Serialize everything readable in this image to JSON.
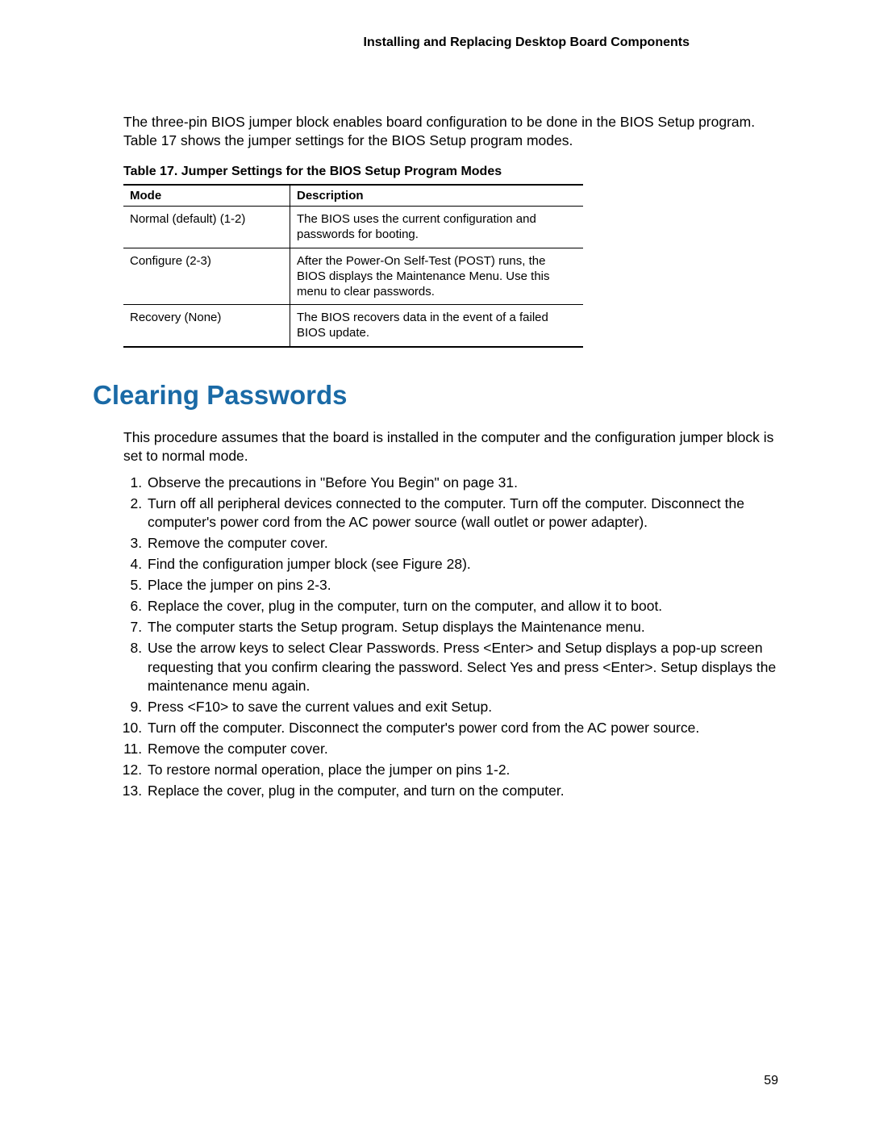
{
  "header": {
    "running_head": "Installing and Replacing Desktop Board Components"
  },
  "intro_paragraph": "The three-pin BIOS jumper block enables board configuration to be done in the BIOS Setup program.  Table 17 shows the jumper settings for the BIOS Setup program modes.",
  "table": {
    "caption": "Table 17. Jumper Settings for the BIOS Setup Program Modes",
    "headers": {
      "c1": "Mode",
      "c2": "Description"
    },
    "rows": [
      {
        "mode": "Normal (default) (1-2)",
        "desc": "The BIOS uses the current configuration and passwords for booting."
      },
      {
        "mode": "Configure (2-3)",
        "desc": "After the Power-On Self-Test (POST) runs, the BIOS displays the Maintenance Menu.  Use this menu to clear passwords."
      },
      {
        "mode": "Recovery (None)",
        "desc": "The BIOS recovers data in the event of a failed BIOS update."
      }
    ]
  },
  "section_heading": "Clearing Passwords",
  "procedure_intro": "This procedure assumes that the board is installed in the computer and the configuration jumper block is set to normal mode.",
  "steps": [
    "Observe the precautions in \"Before You Begin\" on page 31.",
    "Turn off all peripheral devices connected to the computer.  Turn off the computer.  Disconnect the computer's power cord from the AC power source (wall outlet or power adapter).",
    "Remove the computer cover.",
    "Find the configuration jumper block (see Figure 28).",
    "Place the jumper on pins 2-3.",
    "Replace the cover, plug in the computer, turn on the computer, and allow it to boot.",
    "The computer starts the Setup program.  Setup displays the Maintenance menu.",
    "Use the arrow keys to select Clear Passwords.  Press <Enter> and Setup displays a pop-up screen requesting that you confirm clearing the password.  Select Yes and press <Enter>.  Setup displays the maintenance menu again.",
    "Press <F10> to save the current values and exit Setup.",
    "Turn off the computer.  Disconnect the computer's power cord from the AC power source.",
    "Remove the computer cover.",
    "To restore normal operation, place the jumper on pins 1-2.",
    "Replace the cover, plug in the computer, and turn on the computer."
  ],
  "page_number": "59"
}
